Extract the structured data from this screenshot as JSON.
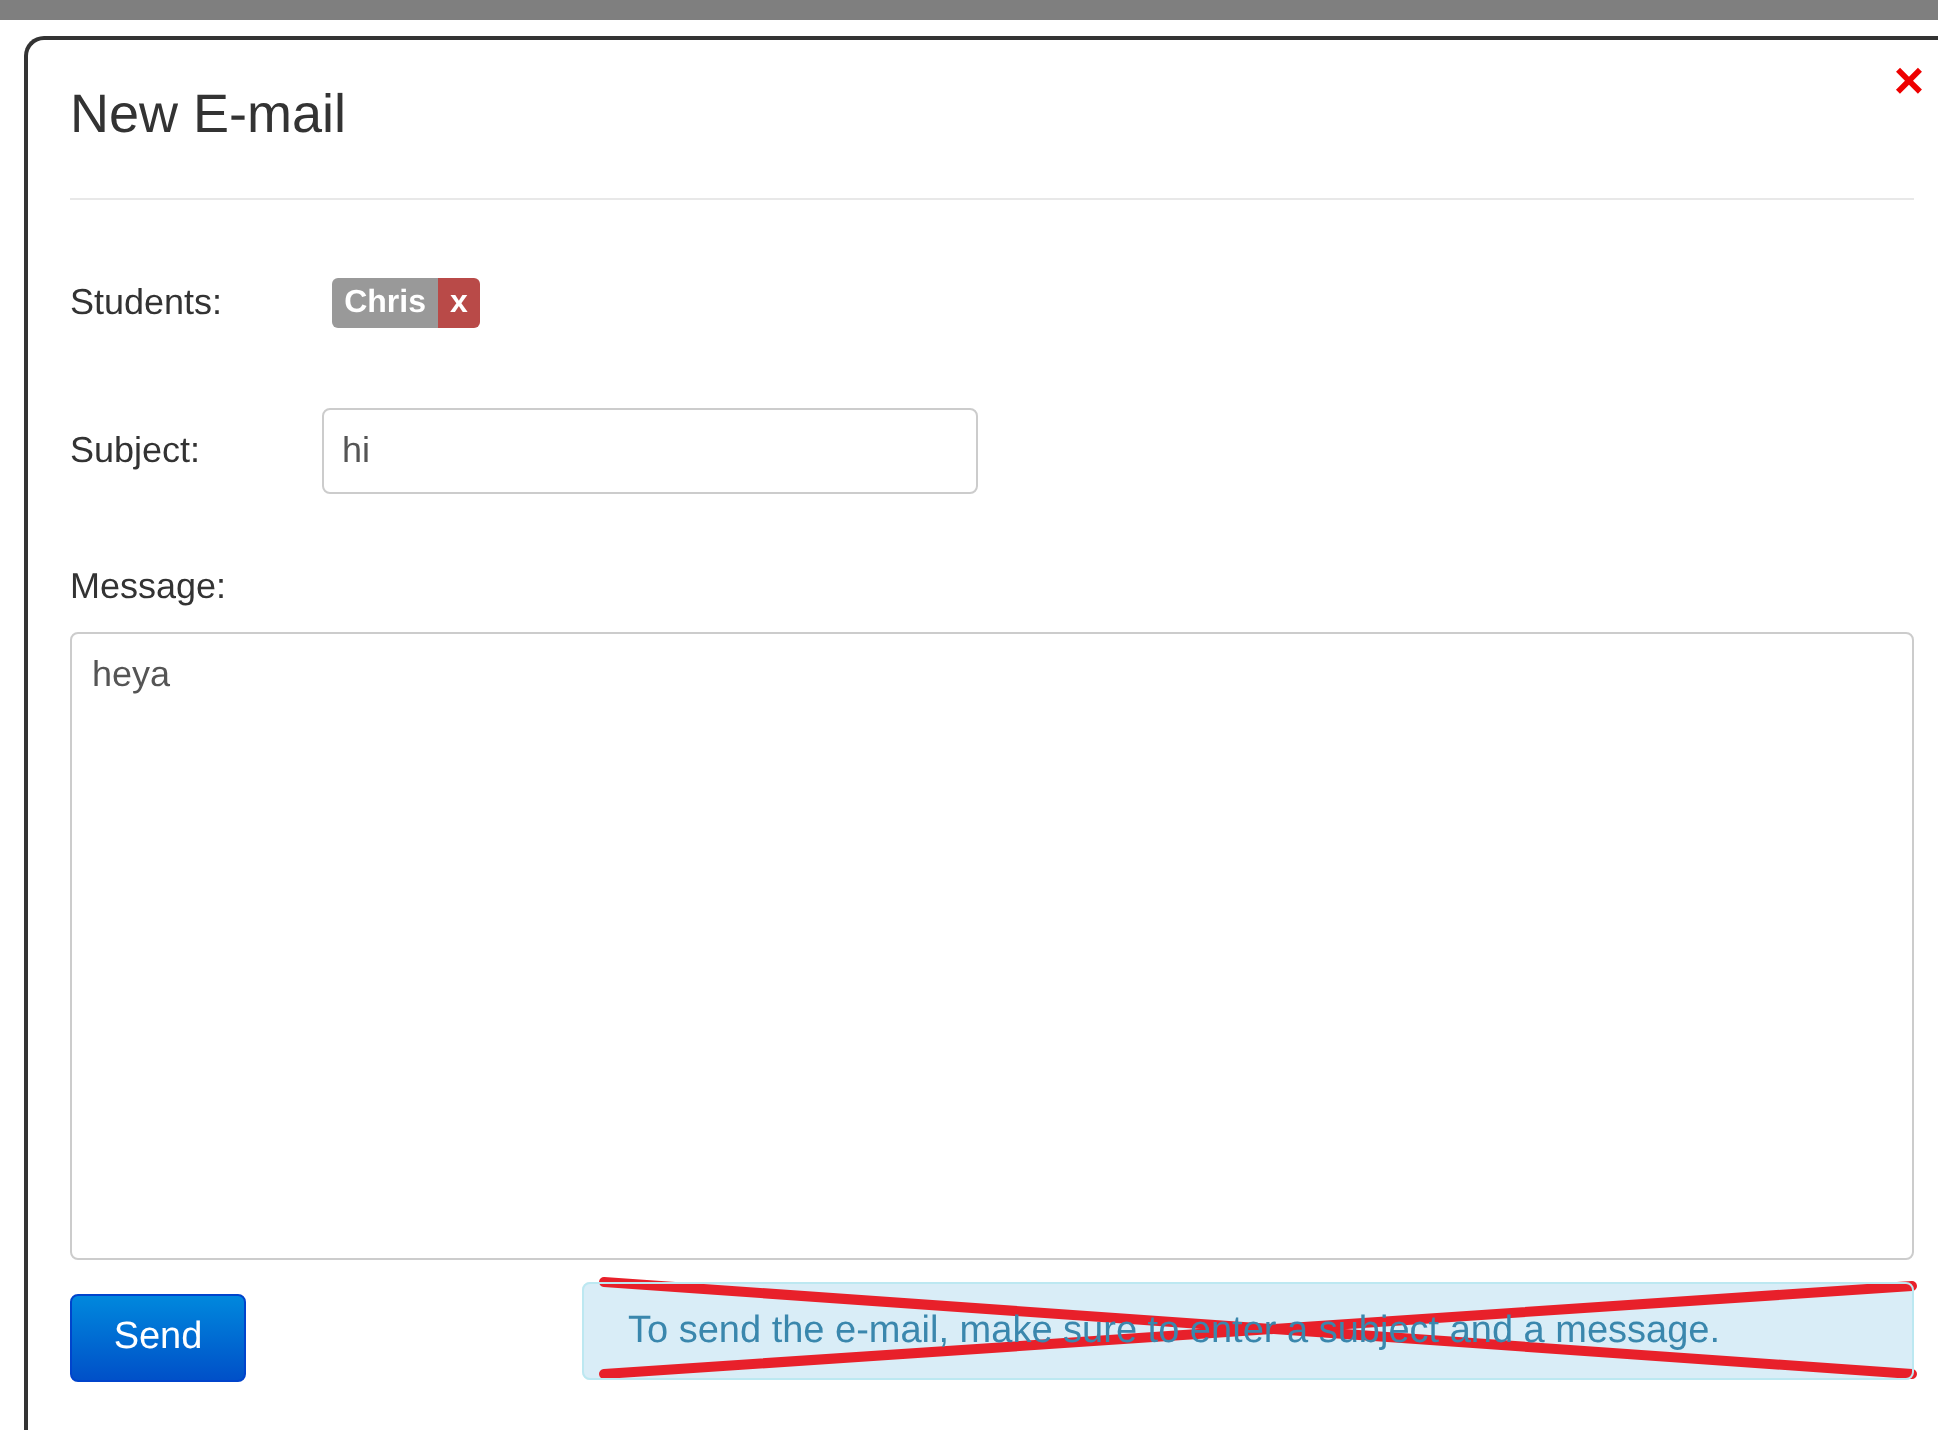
{
  "dialog": {
    "title": "New E-mail",
    "close": "×"
  },
  "students": {
    "label": "Students:",
    "recipients": [
      {
        "name": "Chris",
        "remove": "x"
      }
    ]
  },
  "subject": {
    "label": "Subject:",
    "value": "hi"
  },
  "message": {
    "label": "Message:",
    "value": "heya"
  },
  "send_button": "Send",
  "notice": {
    "text": "To send the e-mail, make sure to enter a subject and a message.",
    "crossed_out": true
  }
}
